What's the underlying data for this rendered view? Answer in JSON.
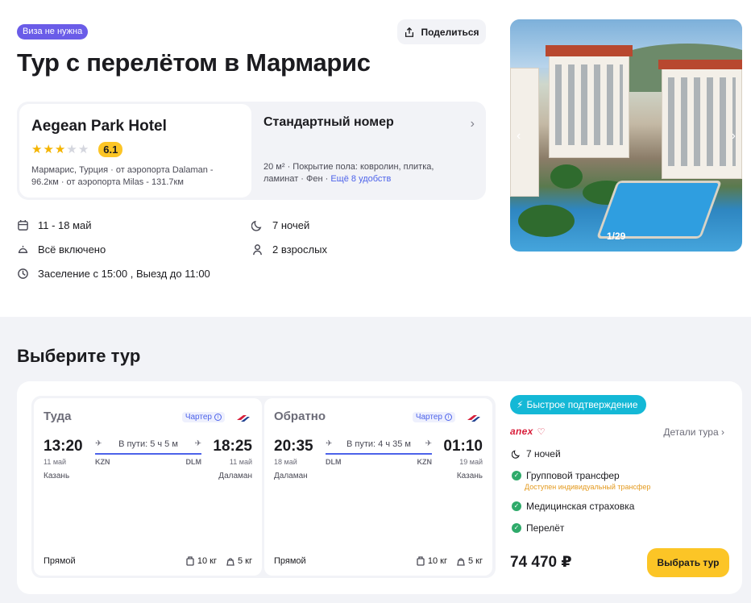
{
  "header": {
    "visa_badge": "Виза не нужна",
    "share_label": "Поделиться",
    "title": "Тур с перелётом в Мармарис"
  },
  "hotel": {
    "name": "Aegean Park Hotel",
    "stars": 3,
    "stars_max": 5,
    "score": "6.1",
    "location": "Мармарис, Турция · от аэропорта Dalaman - 96.2км · от аэропорта Milas - 131.7км"
  },
  "room": {
    "title": "Стандартный номер",
    "desc": "20 м² · Покрытие пола: ковролин, плитка, ламинат · Фен · ",
    "more": "Ещё 8 удобств"
  },
  "facts": {
    "dates": "11 - 18 май",
    "nights": "7 ночей",
    "meal": "Всё включено",
    "guests": "2 взрослых",
    "checkin": "Заселение с 15:00 , Выезд до 11:00"
  },
  "photo": {
    "counter": "1/29"
  },
  "tours": {
    "section_title": "Выберите тур",
    "there": {
      "label": "Туда",
      "charter": "Чартер",
      "dep_time": "13:20",
      "dep_date": "11 май",
      "dep_city": "Казань",
      "dep_iata": "KZN",
      "arr_time": "18:25",
      "arr_date": "11 май",
      "arr_city": "Даламан",
      "arr_iata": "DLM",
      "duration": "В пути: 5 ч 5 м",
      "type": "Прямой",
      "baggage": "10 кг",
      "handbag": "5 кг"
    },
    "back": {
      "label": "Обратно",
      "charter": "Чартер",
      "dep_time": "20:35",
      "dep_date": "18 май",
      "dep_city": "Даламан",
      "dep_iata": "DLM",
      "arr_time": "01:10",
      "arr_date": "19 май",
      "arr_city": "Казань",
      "arr_iata": "KZN",
      "duration": "В пути: 4 ч 35 м",
      "type": "Прямой",
      "baggage": "10 кг",
      "handbag": "5 кг"
    },
    "offer": {
      "fast_label": "Быстрое подтверждение",
      "operator": "anex",
      "details_label": "Детали тура",
      "nights": "7 ночей",
      "transfer": "Групповой трансфер",
      "transfer_note": "Доступен индивидуальный трансфер",
      "insurance": "Медицинская страховка",
      "flight": "Перелёт",
      "price": "74 470 ₽",
      "choose_label": "Выбрать тур"
    }
  },
  "colors": {
    "accent": "#4d63ea",
    "yellow": "#fcc526",
    "cyan": "#14b8d6",
    "visa": "#6a5ce8"
  }
}
